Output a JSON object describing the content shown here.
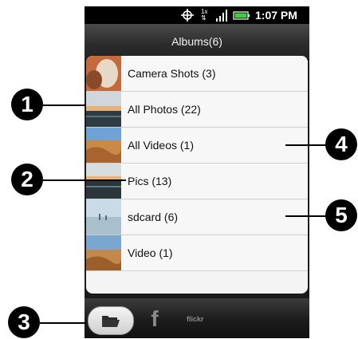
{
  "status_bar": {
    "time": "1:07 PM",
    "net_indicator": "1x",
    "icons": [
      "gps-icon",
      "network-activity-icon",
      "signal-icon",
      "battery-icon"
    ]
  },
  "header": {
    "title": "Albums(6)"
  },
  "albums": [
    {
      "label": "Camera Shots (3)"
    },
    {
      "label": "All Photos (22)"
    },
    {
      "label": "All Videos (1)"
    },
    {
      "label": "Pics (13)"
    },
    {
      "label": "sdcard (6)"
    },
    {
      "label": "Video (1)"
    }
  ],
  "tabs": {
    "folder": "folder-icon",
    "facebook_glyph": "f",
    "flickr_label": "flickr"
  },
  "callouts": [
    "1",
    "2",
    "3",
    "4",
    "5"
  ],
  "colors": {
    "accent": "#000000",
    "list_bg": "#f7f7f7",
    "bar_bg": "#2b2b2b"
  }
}
